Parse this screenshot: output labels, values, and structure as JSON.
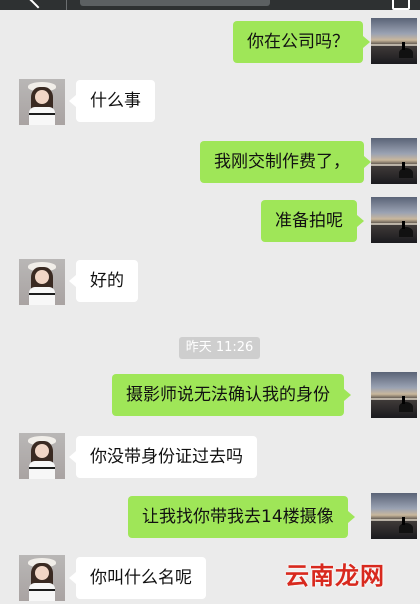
{
  "header": {
    "back_icon": "chevron-left-icon",
    "menu_icon": "menu-icon"
  },
  "messages": [
    {
      "side": "right",
      "text": "你在公司吗？"
    },
    {
      "side": "left",
      "text": "什么事"
    },
    {
      "side": "right",
      "text": "我刚交制作费了，"
    },
    {
      "side": "right",
      "text": "准备拍呢"
    },
    {
      "side": "left",
      "text": "好的"
    },
    {
      "side": "right",
      "text": "摄影师说无法确认我的身份"
    },
    {
      "side": "left",
      "text": "你没带身份证过去吗"
    },
    {
      "side": "right",
      "text": "让我找你带我去14楼摄像"
    },
    {
      "side": "left",
      "text": "你叫什么名呢"
    }
  ],
  "timestamp": "昨天 11:26",
  "watermark": "云南龙网",
  "colors": {
    "background": "#ebebeb",
    "outgoing_bubble": "#9fe658",
    "incoming_bubble": "#ffffff",
    "timestamp_bg": "#cecece",
    "watermark": "#d8291e"
  }
}
